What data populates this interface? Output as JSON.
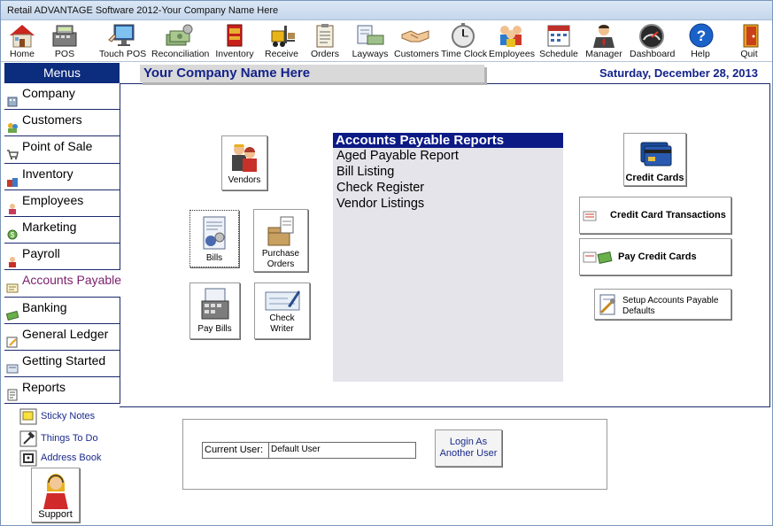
{
  "window": {
    "title": "Retail ADVANTAGE Software 2012-Your Company Name Here"
  },
  "toolbar": [
    {
      "label": "Home",
      "icon": "home-icon"
    },
    {
      "label": "POS",
      "icon": "cash-register-icon"
    },
    {
      "label": "Touch POS",
      "icon": "touch-monitor-icon"
    },
    {
      "label": "Reconciliation",
      "icon": "cash-stack-icon"
    },
    {
      "label": "Inventory",
      "icon": "inventory-box-icon"
    },
    {
      "label": "Receive",
      "icon": "forklift-icon"
    },
    {
      "label": "Orders",
      "icon": "clipboard-icon"
    },
    {
      "label": "Layways",
      "icon": "layaway-bill-icon"
    },
    {
      "label": "Customers",
      "icon": "handshake-icon"
    },
    {
      "label": "Time Clock",
      "icon": "stopwatch-icon"
    },
    {
      "label": "Employees",
      "icon": "people-group-icon"
    },
    {
      "label": "Schedule",
      "icon": "calendar-icon"
    },
    {
      "label": "Manager",
      "icon": "manager-icon"
    },
    {
      "label": "Dashboard",
      "icon": "gauge-icon"
    },
    {
      "label": "Help",
      "icon": "help-icon"
    },
    {
      "label": "Quit",
      "icon": "door-exit-icon"
    }
  ],
  "sidebar": {
    "header": "Menus",
    "items": [
      {
        "label": "Company",
        "icon": "company-icon"
      },
      {
        "label": "Customers",
        "icon": "customers-icon"
      },
      {
        "label": "Point of Sale",
        "icon": "cart-icon"
      },
      {
        "label": "Inventory",
        "icon": "inventory-icon"
      },
      {
        "label": "Employees",
        "icon": "employee-icon"
      },
      {
        "label": "Marketing",
        "icon": "marketing-icon"
      },
      {
        "label": "Payroll",
        "icon": "payroll-icon"
      },
      {
        "label": "Accounts Payable",
        "icon": "accounts-payable-icon",
        "active": true
      },
      {
        "label": "Banking",
        "icon": "banking-icon"
      },
      {
        "label": "General Ledger",
        "icon": "ledger-icon"
      },
      {
        "label": "Getting Started",
        "icon": "getting-started-icon"
      },
      {
        "label": "Reports",
        "icon": "reports-icon"
      }
    ]
  },
  "header": {
    "company_name": "Your Company Name Here",
    "date": "Saturday, December 28, 2013"
  },
  "buttons": {
    "vendors": "Vendors",
    "bills": "Bills",
    "purchase_orders_1": "Purchase",
    "purchase_orders_2": "Orders",
    "pay_bills": "Pay Bills",
    "check_writer_1": "Check",
    "check_writer_2": "Writer"
  },
  "reports": {
    "title": "Accounts Payable Reports",
    "items": [
      "Aged Payable Report",
      "Bill Listing",
      "Check Register",
      "Vendor Listings"
    ]
  },
  "right_buttons": {
    "credit_cards": "Credit Cards",
    "credit_card_transactions": "Credit Card Transactions",
    "pay_credit_cards": "Pay Credit Cards",
    "setup_1": "Setup Accounts Payable",
    "setup_2": "Defaults"
  },
  "quick_links": {
    "sticky_notes": "Sticky Notes",
    "things_to_do": "Things To Do",
    "address_book": "Address Book",
    "support": "Support"
  },
  "user": {
    "label": "Current User:",
    "value": "Default User",
    "login_1": "Login As",
    "login_2": "Another User"
  },
  "colors": {
    "menu_header": "#0c2c7d",
    "accent_text": "#14238a",
    "active_item": "#7b1e6b"
  }
}
